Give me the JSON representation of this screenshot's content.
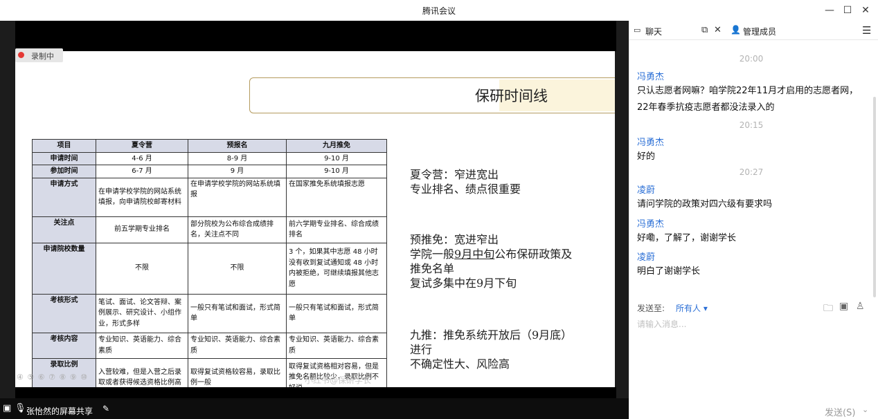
{
  "window": {
    "title": "腾讯会议",
    "minimize": "—",
    "maximize": "☐",
    "close": "✕"
  },
  "recording": {
    "label": "录制中"
  },
  "slide": {
    "title": "保研时间线",
    "table": {
      "headers": [
        "项目",
        "夏令营",
        "预报名",
        "九月推免"
      ],
      "rows": [
        [
          "申请时间",
          "4-6 月",
          "8-9 月",
          "9-10 月"
        ],
        [
          "参加时间",
          "6-7 月",
          "9 月",
          "9-10 月"
        ],
        [
          "申请方式",
          "在申请学校学院的网站系统填报，向申请院校邮寄材料",
          "在申请学校学院的网站系统填报",
          "在国家推免系统填报志愿"
        ],
        [
          "关注点",
          "前五学期专业排名",
          "部分院校为公布综合成绩排名，关注点不同",
          "前六学期专业排名、综合成绩排名"
        ],
        [
          "申请院校数量",
          "不限",
          "不限",
          "3 个，如果其中志愿 48 小时没有收到复试通知或 48 小时内被拒绝，可继续填报其他志愿"
        ],
        [
          "考核形式",
          "笔试、面试、论文答辩、案例展示、研究设计、小组作业，形式多样",
          "一般只有笔试和面试，形式简单",
          "一般只有笔试和面试，形式简单"
        ],
        [
          "考核内容",
          "专业知识、英语能力、综合素质",
          "专业知识、英语能力、综合素质",
          "专业知识、英语能力、综合素质"
        ],
        [
          "录取比例",
          "入营较难，但是入营之后录取或者获得候选资格比例高",
          "取得复试资格较容易，录取比例一般",
          "取得复试资格相对容易，但是推免名额比较少，录取比例不好说"
        ]
      ]
    },
    "notes": {
      "n1_line1": "夏令营：窄进宽出",
      "n1_line2": "专业排名、绩点很重要",
      "n2_line1": "预推免：宽进窄出",
      "n2_line2a": "学院一般",
      "n2_line2u": "9月中旬",
      "n2_line2b": "公布保研政策及",
      "n2_line3": "推免名单",
      "n2_line4": "复试多集中在9月下旬",
      "n3_line1": "九推：推免系统开放后（9月底）",
      "n3_line2": "进行",
      "n3_line3": "不确定性大、风险高"
    },
    "watermark": "小红书@保研学长"
  },
  "share_footer": {
    "label": "张怡然的屏幕共享"
  },
  "chat": {
    "tab_chat": "聊天",
    "tab_members": "管理成员",
    "messages": [
      {
        "time": "20:00",
        "sender": "冯勇杰",
        "text": "只认志愿者网嘛？咱学院22年11月才启用的志愿者网，22年春季抗疫志愿者都没法录入的"
      },
      {
        "time": "20:15",
        "sender": "冯勇杰",
        "text": "好的"
      },
      {
        "time": "20:27",
        "sender": "凌蔚",
        "text": "请问学院的政策对四六级有要求吗"
      },
      {
        "time": "",
        "sender": "冯勇杰",
        "text": "好嘞，了解了，谢谢学长"
      },
      {
        "time": "",
        "sender": "凌蔚",
        "text": "明白了谢谢学长"
      }
    ],
    "send_to_label": "发送至:",
    "send_to_value": "所有人 ▾",
    "input_placeholder": "请输入消息...",
    "send_button": "发送(S)"
  }
}
